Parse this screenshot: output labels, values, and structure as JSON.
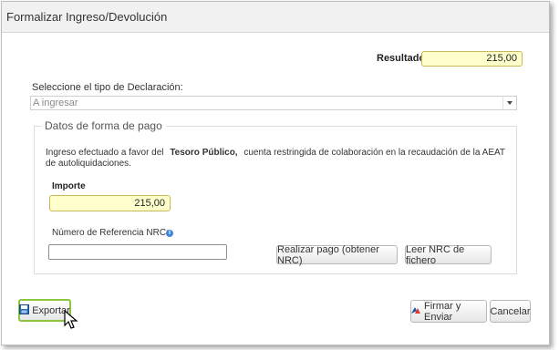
{
  "window": {
    "title": "Formalizar Ingreso/Devolución"
  },
  "resultado": {
    "label": "Resultado",
    "value": "215,00"
  },
  "declaracion": {
    "label": "Seleccione el tipo de Declaración:",
    "selected": "A ingresar"
  },
  "pago": {
    "legend": "Datos de forma de pago",
    "text_before": "Ingreso efectuado a favor del",
    "text_bold": "Tesoro Público,",
    "text_after": "cuenta restringida de colaboración en la recaudación de la AEAT de autoliquidaciones.",
    "importe_label": "Importe",
    "importe_value": "215,00",
    "nrc_label": "Número de Referencia NRC:",
    "nrc_value": "",
    "realizar_pago_label": "Realizar pago (obtener NRC)",
    "leer_nrc_label": "Leer NRC de fichero"
  },
  "footer": {
    "exportar_label": "Exportar",
    "firmar_label": "Firmar y Enviar",
    "cancelar_label": "Cancelar"
  }
}
